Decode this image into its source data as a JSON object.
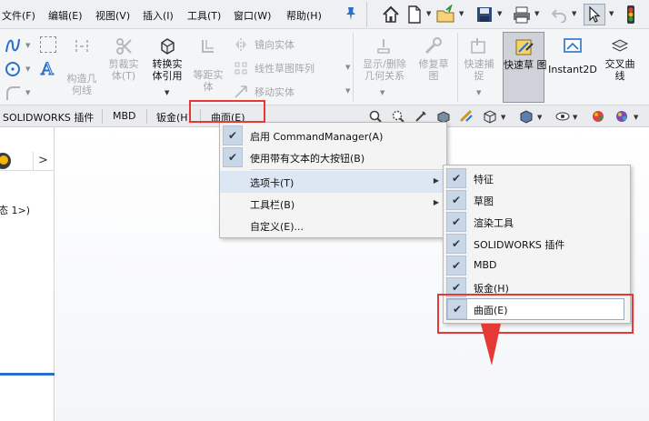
{
  "menubar": {
    "items": [
      "文件(F)",
      "编辑(E)",
      "视图(V)",
      "插入(I)",
      "工具(T)",
      "窗口(W)",
      "帮助(H)"
    ],
    "icons": [
      "pin-icon",
      "home-icon",
      "new-document-icon",
      "open-folder-icon",
      "save-icon",
      "print-icon",
      "undo-icon",
      "select-arrow-icon",
      "rebuild-icon"
    ]
  },
  "ribbon": {
    "buttons": [
      {
        "label": "构造几\n何线",
        "state": "disabled"
      },
      {
        "label": "剪裁实\n体(T)",
        "state": "disabled"
      },
      {
        "label": "转换实\n体引用",
        "state": "enabled"
      },
      {
        "label": "等距实\n体",
        "state": "disabled"
      },
      {
        "label": "镜向实体",
        "state": "disabled"
      },
      {
        "label": "线性草图阵列",
        "state": "disabled"
      },
      {
        "label": "移动实体",
        "state": "disabled"
      },
      {
        "label": "显示/删除\n几何关系",
        "state": "disabled"
      },
      {
        "label": "修复草\n图",
        "state": "disabled"
      },
      {
        "label": "快速捕\n捉",
        "state": "disabled"
      },
      {
        "label": "快速草\n图",
        "state": "active"
      },
      {
        "label": "Instant2D",
        "state": "enabled"
      },
      {
        "label": "交叉曲\n线",
        "state": "enabled"
      }
    ]
  },
  "tabs": [
    "SOLIDWORKS 插件",
    "MBD",
    "钣金(H)",
    "曲面(E)"
  ],
  "leftpanel": {
    "tree_item": "态 1>)",
    "chevron": ">"
  },
  "context_menu": {
    "items": [
      {
        "label": "启用 CommandManager(A)",
        "checked": true
      },
      {
        "label": "使用带有文本的大按钮(B)",
        "checked": true
      },
      {
        "label": "选项卡(T)",
        "submenu": true,
        "highlighted": true
      },
      {
        "label": "工具栏(B)",
        "submenu": true
      },
      {
        "label": "自定义(E)..."
      }
    ]
  },
  "submenu": {
    "items": [
      {
        "label": "特征",
        "checked": true
      },
      {
        "label": "草图",
        "checked": true
      },
      {
        "label": "渲染工具",
        "checked": true
      },
      {
        "label": "SOLIDWORKS 插件",
        "checked": true
      },
      {
        "label": "MBD",
        "checked": true
      },
      {
        "label": "钣金(H)",
        "checked": true
      },
      {
        "label": "曲面(E)",
        "checked": true,
        "highlighted": true
      }
    ]
  },
  "colors": {
    "annotation": "#e53935",
    "check_bg": "#c9d6e6",
    "highlight_bg": "#cfe0f3"
  }
}
